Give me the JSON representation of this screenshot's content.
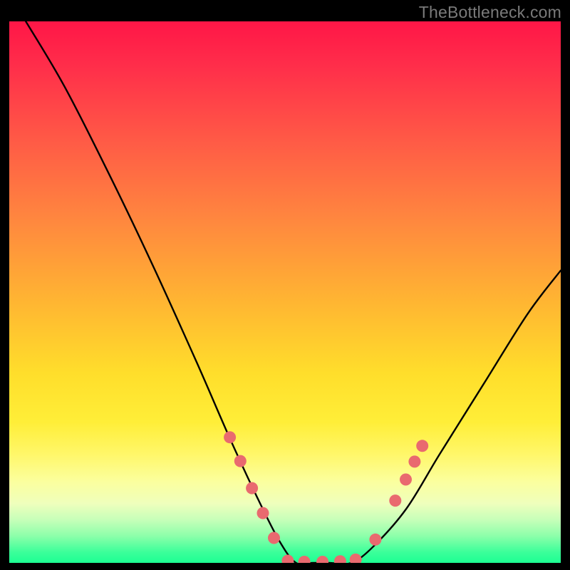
{
  "watermark": "TheBottleneck.com",
  "colors": {
    "background": "#000000",
    "curve_stroke": "#000000",
    "marker_fill": "#e96a6f",
    "gradient_top": "#ff1647",
    "gradient_bottom": "#1dff93"
  },
  "chart_data": {
    "type": "line",
    "title": "",
    "xlabel": "",
    "ylabel": "",
    "xlim": [
      0,
      100
    ],
    "ylim": [
      0,
      100
    ],
    "grid": false,
    "note": "No axis ticks or numeric labels are rendered; values are approximate positions in percent of plot width/height (y=0 at bottom).",
    "series": [
      {
        "name": "bottleneck-curve",
        "x": [
          3,
          10,
          18,
          26,
          34,
          40,
          45,
          49,
          52,
          55,
          58,
          62,
          66,
          72,
          78,
          86,
          94,
          100
        ],
        "y": [
          100,
          88,
          72,
          55,
          37,
          23,
          12,
          4,
          0,
          0,
          0,
          0,
          3,
          10,
          20,
          33,
          46,
          54
        ]
      }
    ],
    "markers": {
      "name": "highlight-dots",
      "color": "#e96a6f",
      "x": [
        40.0,
        41.9,
        44.0,
        46.0,
        48.0,
        50.5,
        53.5,
        56.8,
        60.0,
        62.8,
        66.4,
        70.0,
        71.9,
        73.5,
        74.9
      ],
      "y": [
        23.2,
        18.8,
        13.8,
        9.2,
        4.6,
        0.4,
        0.2,
        0.2,
        0.3,
        0.6,
        4.3,
        11.5,
        15.4,
        18.7,
        21.6
      ]
    }
  }
}
